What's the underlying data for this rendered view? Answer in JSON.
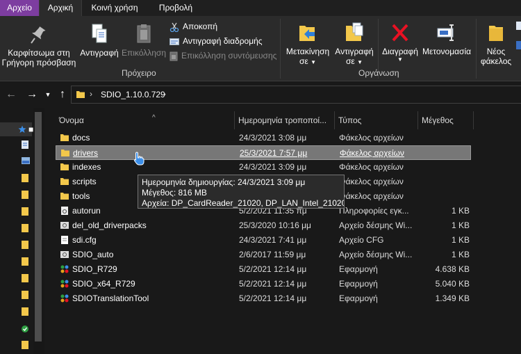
{
  "tabs": {
    "file": "Αρχείο",
    "home": "Αρχική",
    "share": "Κοινή χρήση",
    "view": "Προβολή"
  },
  "ribbon": {
    "clipboard": {
      "pin": "Καρφίτσωμα στη Γρήγορη πρόσβαση",
      "copy": "Αντιγραφή",
      "paste": "Επικόλληση",
      "cut": "Αποκοπή",
      "copy_path": "Αντιγραφή διαδρομής",
      "paste_shortcut": "Επικόλληση συντόμευσης",
      "group_label": "Πρόχειρο"
    },
    "organize": {
      "move_to": "Μετακίνηση σε",
      "copy_to": "Αντιγραφή σε",
      "delete": "Διαγραφή",
      "rename": "Μετονομασία",
      "group_label": "Οργάνωση"
    },
    "new": {
      "new_folder": "Νέος φάκελος"
    }
  },
  "address": {
    "path": "SDIO_1.10.0.729"
  },
  "columns": {
    "name": "Όνομα",
    "date": "Ημερομηνία τροποποί...",
    "type": "Τύπος",
    "size": "Μέγεθος"
  },
  "files": [
    {
      "name": "docs",
      "date": "24/3/2021 3:08 μμ",
      "type": "Φάκελος αρχείων",
      "size": "",
      "icon": "folder-icon"
    },
    {
      "name": "drivers",
      "date": "25/3/2021 7:57 μμ",
      "type": "Φάκελος αρχείων",
      "size": "",
      "icon": "folder-icon"
    },
    {
      "name": "indexes",
      "date": "24/3/2021 3:09 μμ",
      "type": "Φάκελος αρχείων",
      "size": "",
      "icon": "folder-icon"
    },
    {
      "name": "scripts",
      "date": "24/3/2021 3:09 μμ",
      "type": "Φάκελος αρχείων",
      "size": "",
      "icon": "folder-icon"
    },
    {
      "name": "tools",
      "date": "24/3/2021 3:09 μμ",
      "type": "Φάκελος αρχείων",
      "size": "",
      "icon": "folder-icon"
    },
    {
      "name": "autorun",
      "date": "5/2/2021 11:35 πμ",
      "type": "Πληροφορίες εγκ...",
      "size": "1 KB",
      "icon": "settings-file-icon"
    },
    {
      "name": "del_old_driverpacks",
      "date": "25/3/2020 10:16 μμ",
      "type": "Αρχείο δέσμης Wi...",
      "size": "1 KB",
      "icon": "batch-file-icon"
    },
    {
      "name": "sdi.cfg",
      "date": "24/3/2021 7:41 μμ",
      "type": "Αρχείο CFG",
      "size": "1 KB",
      "icon": "text-file-icon"
    },
    {
      "name": "SDIO_auto",
      "date": "2/6/2017 11:59 μμ",
      "type": "Αρχείο δέσμης Wi...",
      "size": "1 KB",
      "icon": "batch-file-icon"
    },
    {
      "name": "SDIO_R729",
      "date": "5/2/2021 12:14 μμ",
      "type": "Εφαρμογή",
      "size": "4.638 KB",
      "icon": "app-icon"
    },
    {
      "name": "SDIO_x64_R729",
      "date": "5/2/2021 12:14 μμ",
      "type": "Εφαρμογή",
      "size": "5.040 KB",
      "icon": "app-icon"
    },
    {
      "name": "SDIOTranslationTool",
      "date": "5/2/2021 12:14 μμ",
      "type": "Εφαρμογή",
      "size": "1.349 KB",
      "icon": "app-icon"
    }
  ],
  "tooltip": {
    "line1": "Ημερομηνία δημιουργίας: 24/3/2021 3:09 μμ",
    "line2": "Μέγεθος: 816 MB",
    "line3": "Αρχεία: DP_CardReader_21020, DP_LAN_Intel_21020, ..."
  },
  "colors": {
    "file_tab": "#7d3da0",
    "ribbon_bg": "#2b2b2b",
    "window_bg": "#191919",
    "folder_yellow": "#f3c84b",
    "delete_red": "#e81123"
  }
}
